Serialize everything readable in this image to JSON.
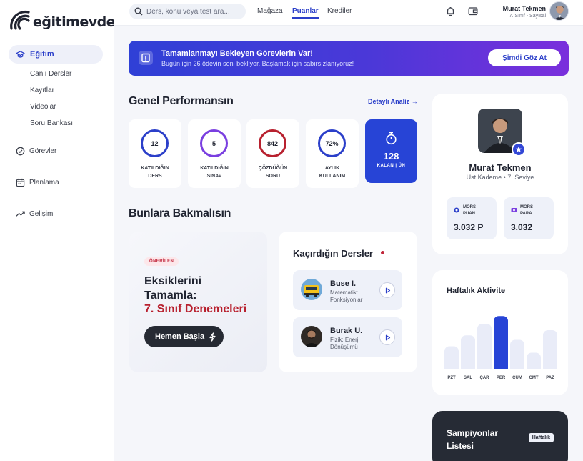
{
  "logo": {
    "part1": "eğitim",
    "part2": "evde"
  },
  "sidebar": {
    "main": {
      "label": "Eğitim",
      "icon": "graduation-cap-icon"
    },
    "sub_items": [
      "Canlı Dersler",
      "Kayıtlar",
      "Videolar",
      "Soru Bankası"
    ],
    "items": [
      {
        "label": "Görevler",
        "icon": "check-circle-icon"
      },
      {
        "label": "Planlama",
        "icon": "calendar-icon"
      },
      {
        "label": "Gelişim",
        "icon": "trend-up-icon"
      }
    ]
  },
  "topbar": {
    "search_placeholder": "Ders, konu veya test ara...",
    "links": [
      "Mağaza",
      "Puanlar",
      "Krediler"
    ],
    "active_link": "Puanlar",
    "user_name": "Murat Tekmen",
    "user_class": "7. Sınıf - Sayısal"
  },
  "banner": {
    "title": "Tamamlanmayı Bekleyen Görevlerin Var!",
    "subtitle": "Bugün için 26 ödevin seni bekliyor. Başlamak için sabırsızlanıyoruz!",
    "button": "Şimdi Göz At"
  },
  "performance": {
    "title": "Genel Performansın",
    "detail_link": "Detaylı Analiz",
    "stats": [
      {
        "value": "12",
        "label1": "KATILDIĞIN",
        "label2": "DERS",
        "color": "#2b3fc9"
      },
      {
        "value": "5",
        "label1": "KATILDIĞIN",
        "label2": "SINAV",
        "color": "#7a3fe0"
      },
      {
        "value": "842",
        "label1": "ÇÖZDÜĞÜN",
        "label2": "SORU",
        "color": "#b8212f"
      },
      {
        "value": "72%",
        "label1": "AYLIK",
        "label2": "KULLANIM",
        "color": "#2b3fc9"
      }
    ],
    "remaining": {
      "value": "128",
      "label": "KALAN | ÜN"
    }
  },
  "look": {
    "title": "Bunlara Bakmalısın",
    "recommended": {
      "pill": "ÖNERİLEN",
      "line1": "Eksiklerini",
      "line2": "Tamamla:",
      "line3": "7. Sınıf Denemeleri",
      "button": "Hemen Başla"
    },
    "missed": {
      "title": "Kaçırdığın Dersler",
      "lessons": [
        {
          "name": "Buse I.",
          "subject1": "Matematik:",
          "subject2": "Fonksiyonlar"
        },
        {
          "name": "Burak U.",
          "subject1": "Fizik: Enerji",
          "subject2": "Dönüşümü"
        }
      ]
    }
  },
  "profile": {
    "name": "Murat Tekmen",
    "level": "Üst Kademe • 7. Seviye",
    "points": {
      "l1": "MORS",
      "l2": "PUAN",
      "value": "3.032 P"
    },
    "money": {
      "l1": "MORS",
      "l2": "PARA",
      "value": "3.032"
    }
  },
  "weekly": {
    "title": "Haftalık Aktivite",
    "chart_data": {
      "type": "bar",
      "categories": [
        "PZT",
        "SAL",
        "ÇAR",
        "PER",
        "CUM",
        "CMT",
        "PAZ"
      ],
      "values": [
        35,
        52,
        70,
        82,
        45,
        25,
        60
      ],
      "highlight": "PER",
      "colors": {
        "normal": "#e9ecf8",
        "highlight": "#2744d6"
      }
    }
  },
  "champions": {
    "line1": "Sampiyonlar",
    "line2": "Listesi",
    "badge": "Haftalık"
  }
}
